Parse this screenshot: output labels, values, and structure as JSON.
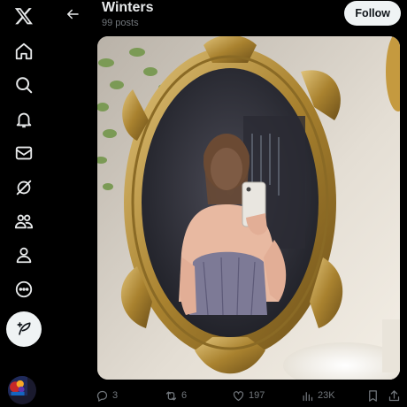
{
  "header": {
    "title": "Winters",
    "subtitle": "99 posts",
    "follow_label": "Follow"
  },
  "nav": {
    "items": [
      {
        "icon": "x-logo-icon"
      },
      {
        "icon": "home-icon"
      },
      {
        "icon": "search-icon"
      },
      {
        "icon": "bell-icon"
      },
      {
        "icon": "mail-icon"
      },
      {
        "icon": "grok-icon"
      },
      {
        "icon": "communities-icon"
      },
      {
        "icon": "profile-icon"
      },
      {
        "icon": "more-icon"
      },
      {
        "icon": "compose-icon"
      }
    ]
  },
  "actions": {
    "replies": "3",
    "reposts": "6",
    "likes": "197",
    "views": "23K"
  },
  "colors": {
    "background": "#000000",
    "text": "#e7e9ea",
    "muted": "#71767b",
    "button_bg": "#eff3f4"
  }
}
